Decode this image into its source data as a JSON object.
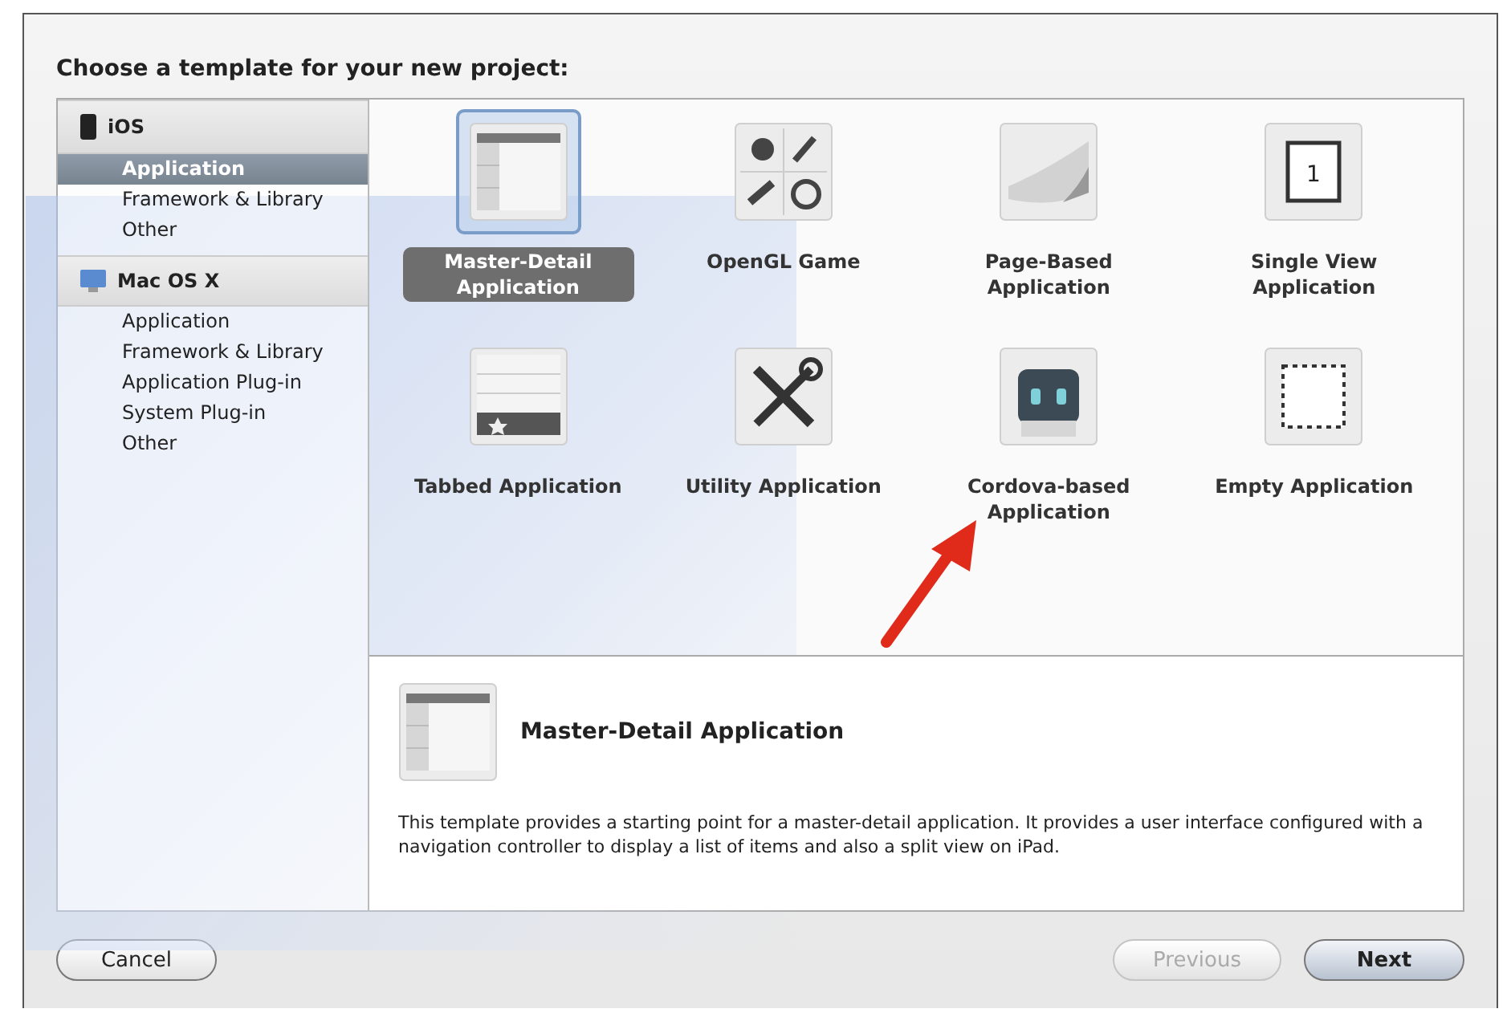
{
  "heading": "Choose a template for your new project:",
  "sidebar": {
    "sections": [
      {
        "title": "iOS",
        "items": [
          {
            "label": "Application",
            "selected": true
          },
          {
            "label": "Framework & Library",
            "selected": false
          },
          {
            "label": "Other",
            "selected": false
          }
        ]
      },
      {
        "title": "Mac OS X",
        "items": [
          {
            "label": "Application",
            "selected": false
          },
          {
            "label": "Framework & Library",
            "selected": false
          },
          {
            "label": "Application Plug-in",
            "selected": false
          },
          {
            "label": "System Plug-in",
            "selected": false
          },
          {
            "label": "Other",
            "selected": false
          }
        ]
      }
    ]
  },
  "templates": [
    {
      "label": "Master-Detail Application",
      "selected": true
    },
    {
      "label": "OpenGL Game",
      "selected": false
    },
    {
      "label": "Page-Based Application",
      "selected": false
    },
    {
      "label": "Single View Application",
      "selected": false
    },
    {
      "label": "Tabbed Application",
      "selected": false
    },
    {
      "label": "Utility Application",
      "selected": false
    },
    {
      "label": "Cordova-based Application",
      "selected": false
    },
    {
      "label": "Empty Application",
      "selected": false
    }
  ],
  "single_view_icon_text": "1",
  "detail": {
    "title": "Master-Detail Application",
    "description": "This template provides a starting point for a master-detail application. It provides a user interface configured with a navigation controller to display a list of items and also a split view on iPad."
  },
  "buttons": [
    {
      "label": "Cancel",
      "disabled": false
    },
    {
      "label": "Previous",
      "disabled": true
    },
    {
      "label": "Next",
      "disabled": false
    }
  ]
}
